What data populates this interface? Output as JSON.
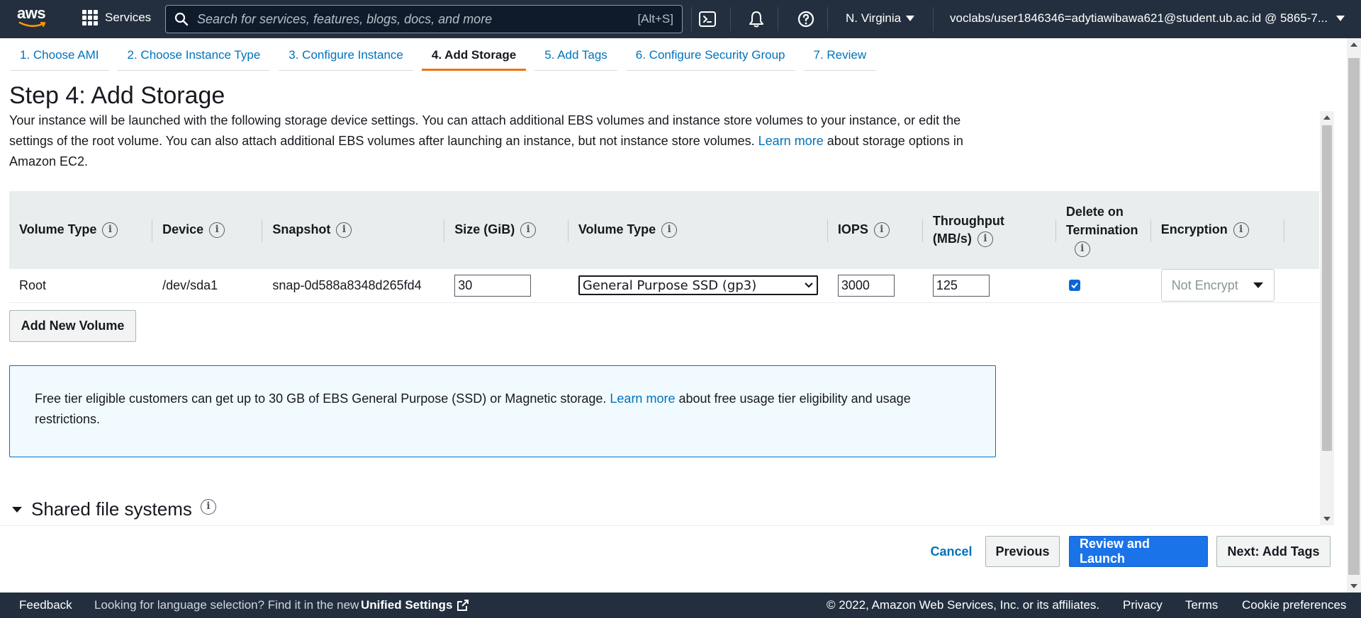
{
  "topnav": {
    "logo_text": "aws",
    "services_label": "Services",
    "search_placeholder": "Search for services, features, blogs, docs, and more",
    "search_shortcut": "[Alt+S]",
    "region": "N. Virginia",
    "account": "voclabs/user1846346=adytiawibawa621@student.ub.ac.id @ 5865-7..."
  },
  "tabs": [
    {
      "label": "1. Choose AMI"
    },
    {
      "label": "2. Choose Instance Type"
    },
    {
      "label": "3. Configure Instance"
    },
    {
      "label": "4. Add Storage"
    },
    {
      "label": "5. Add Tags"
    },
    {
      "label": "6. Configure Security Group"
    },
    {
      "label": "7. Review"
    }
  ],
  "page": {
    "title": "Step 4: Add Storage",
    "desc_part1": "Your instance will be launched with the following storage device settings. You can attach additional EBS volumes and instance store volumes to your instance, or edit the settings of the root volume. You can also attach additional EBS volumes after launching an instance, but not instance store volumes.",
    "desc_link": "Learn more",
    "desc_part2": "about storage options in Amazon EC2."
  },
  "table": {
    "headers": {
      "volume_type": "Volume Type",
      "device": "Device",
      "snapshot": "Snapshot",
      "size": "Size (GiB)",
      "volume_type2": "Volume Type",
      "iops": "IOPS",
      "throughput_l1": "Throughput",
      "throughput_l2": "(MB/s)",
      "delete_l1": "Delete on",
      "delete_l2": "Termination",
      "encryption": "Encryption"
    },
    "row": {
      "volume_type": "Root",
      "device": "/dev/sda1",
      "snapshot": "snap-0d588a8348d265fd4",
      "size": "30",
      "volume_type_select": "General Purpose SSD (gp3)",
      "iops": "3000",
      "throughput": "125",
      "delete_on_termination": true,
      "encryption": "Not Encrypt"
    }
  },
  "add_volume_label": "Add New Volume",
  "alert": {
    "part1": "Free tier eligible customers can get up to 30 GB of EBS General Purpose (SSD) or Magnetic storage.",
    "link": "Learn more",
    "part2": "about free usage tier eligibility and usage restrictions."
  },
  "shared_fs_title": "Shared file systems",
  "actions": {
    "cancel": "Cancel",
    "previous": "Previous",
    "review_launch": "Review and Launch",
    "next": "Next: Add Tags"
  },
  "footer": {
    "feedback": "Feedback",
    "lang_text": "Looking for language selection? Find it in the new",
    "unified_settings": "Unified Settings",
    "copyright": "© 2022, Amazon Web Services, Inc. or its affiliates.",
    "privacy": "Privacy",
    "terms": "Terms",
    "cookie": "Cookie preferences"
  },
  "colors": {
    "nav_bg": "#232f3e",
    "link": "#0073bb",
    "active_tab": "#ec7211",
    "primary_button": "#1a73e8"
  }
}
